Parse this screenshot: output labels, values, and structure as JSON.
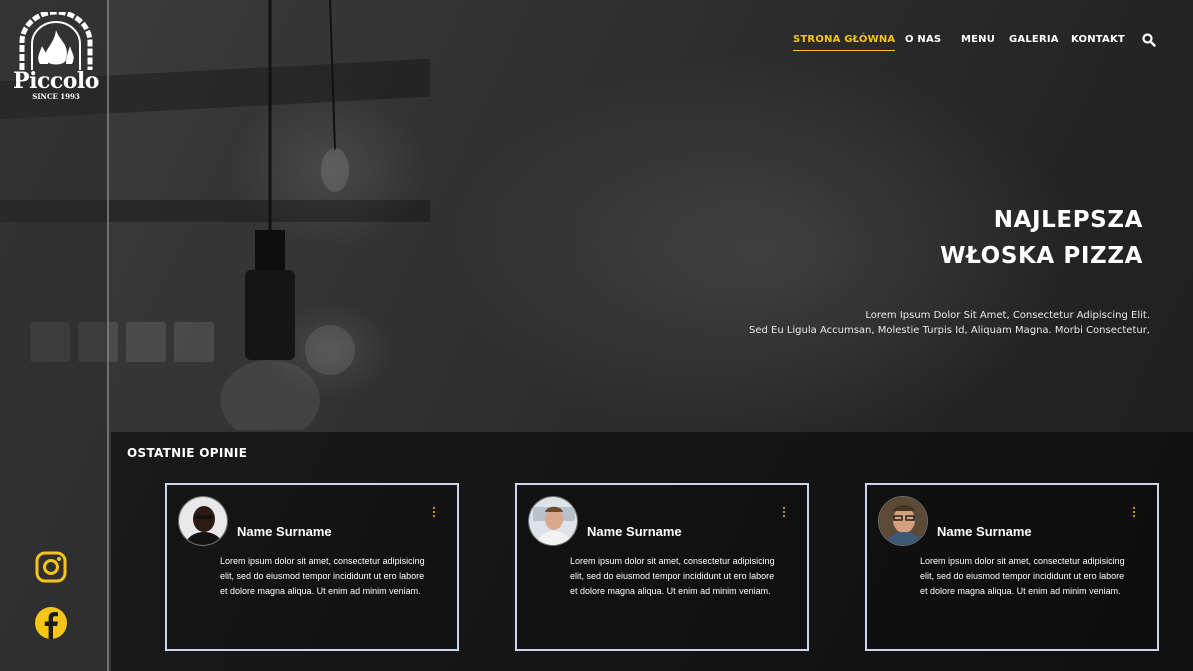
{
  "brand": {
    "name": "Piccolo",
    "since": "SINCE 1993",
    "accent_color": "#f5c518"
  },
  "nav": {
    "items": [
      {
        "label": "STRONA GŁÓWNA",
        "active": true
      },
      {
        "label": "O NAS",
        "active": false
      },
      {
        "label": "MENU",
        "active": false
      },
      {
        "label": "GALERIA",
        "active": false
      },
      {
        "label": "KONTAKT",
        "active": false
      }
    ],
    "search_icon": "search-icon"
  },
  "hero": {
    "title_line1": "NAJLEPSZA",
    "title_line2": "WŁOSKA PIZZA",
    "subtitle_line1": "Lorem Ipsum Dolor Sit Amet, Consectetur Adipiscing Elit.",
    "subtitle_line2": "Sed Eu Ligula Accumsan, Molestie Turpis Id, Aliquam Magna. Morbi Consectetur,"
  },
  "social": {
    "instagram_icon": "instagram-icon",
    "facebook_icon": "facebook-icon"
  },
  "reviews": {
    "title": "OSTATNIE OPINIE",
    "cards": [
      {
        "name": "Name Surname",
        "text": "Lorem ipsum dolor sit amet, consectetur adipisicing elit, sed do eiusmod tempor incididunt ut ero labore et dolore magna aliqua. Ut enim ad minim veniam."
      },
      {
        "name": "Name Surname",
        "text": "Lorem ipsum dolor sit amet, consectetur adipisicing elit, sed do eiusmod tempor incididunt ut ero labore et dolore magna aliqua. Ut enim ad minim veniam."
      },
      {
        "name": "Name Surname",
        "text": "Lorem ipsum dolor sit amet, consectetur adipisicing elit, sed do eiusmod tempor incididunt ut ero labore et dolore magna aliqua. Ut enim ad minim veniam."
      }
    ]
  }
}
